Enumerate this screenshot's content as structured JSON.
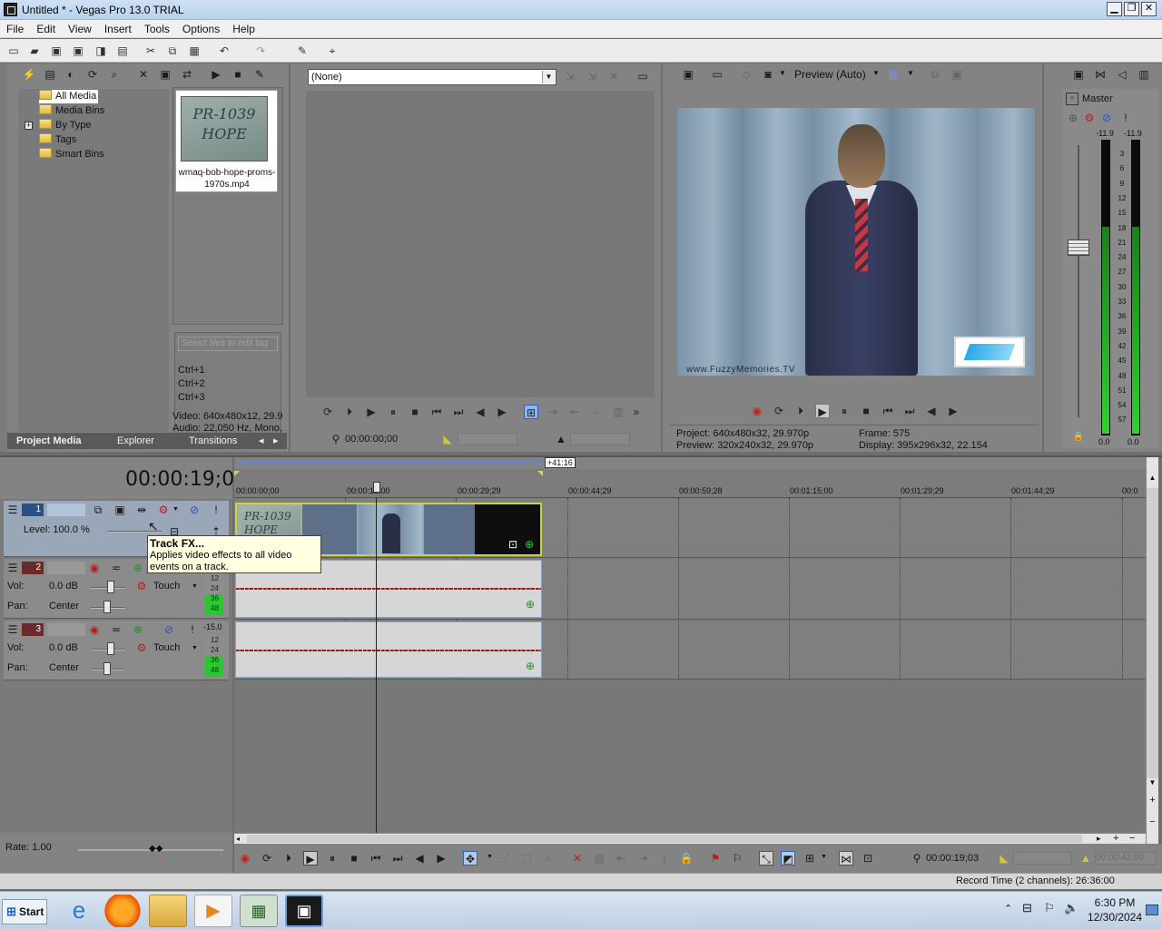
{
  "window": {
    "title": "Untitled * - Vegas Pro 13.0 TRIAL",
    "min": "▁",
    "restore": "❐",
    "close": "✕"
  },
  "menu": [
    "File",
    "Edit",
    "View",
    "Insert",
    "Tools",
    "Options",
    "Help"
  ],
  "project_media": {
    "tree": [
      "All Media",
      "Media Bins",
      "By Type",
      "Tags",
      "Smart Bins"
    ],
    "thumb_text": "PR-1039 HOPE",
    "file_name": "wmaq-bob-hope-proms-1970s.mp4",
    "tag_placeholder": "Select files to edit tag",
    "shortcuts": [
      "Ctrl+1",
      "Ctrl+2",
      "Ctrl+3"
    ],
    "video_info": "Video: 640x480x12, 29.9",
    "audio_info": "Audio: 22,050 Hz, Mono,",
    "tabs": [
      "Project Media",
      "Explorer",
      "Transitions"
    ]
  },
  "trimmer": {
    "combo": "(None)",
    "timecode": "00:00:00;00"
  },
  "preview": {
    "mode": "Preview (Auto)",
    "watermark": "www.FuzzyMemories.TV",
    "project": "Project:  640x480x32, 29.970p",
    "preview_res": "Preview:  320x240x32, 29.970p",
    "frame": "Frame:     575",
    "display": "Display:   395x296x32, 22.154"
  },
  "master": {
    "label": "Master",
    "peak_l": "-11.9",
    "peak_r": "-11.9",
    "scale": [
      "3",
      "6",
      "9",
      "12",
      "15",
      "18",
      "21",
      "24",
      "27",
      "30",
      "33",
      "36",
      "39",
      "42",
      "45",
      "48",
      "51",
      "54",
      "57"
    ],
    "bottom_l": "0.0",
    "bottom_r": "0.0"
  },
  "timeline": {
    "cursor_time": "00:00:19;03",
    "loop_label": "+41:16",
    "ruler": [
      "00:00:00;00",
      "00:00:15;00",
      "00:00:29;29",
      "00:00:44;29",
      "00:00:59;28",
      "00:01:15;00",
      "00:01:29;29",
      "00:01:44;29",
      "00:0"
    ],
    "tracks": [
      {
        "num": "1",
        "level": "Level: 100.0 %"
      },
      {
        "num": "2",
        "vol_label": "Vol:",
        "vol": "0.0 dB",
        "pan_label": "Pan:",
        "pan": "Center",
        "mode": "Touch",
        "meter": [
          "12",
          "24",
          "36",
          "48"
        ]
      },
      {
        "num": "3",
        "vol_label": "Vol:",
        "vol": "0.0 dB",
        "pan_label": "Pan:",
        "pan": "Center",
        "mode": "Touch",
        "peak": "-15.0",
        "meter": [
          "12",
          "24",
          "36",
          "48"
        ]
      }
    ],
    "tooltip_title": "Track FX...",
    "tooltip_body": "Applies video effects to all video events on a track.",
    "rate": "Rate: 1.00",
    "bottom_time": "00:00:19;03",
    "bottom_time2": "00:00:42;00",
    "record_time": "Record Time (2 channels): 26:36:00"
  },
  "taskbar": {
    "start": "Start",
    "time": "6:30 PM",
    "date": "12/30/2024"
  }
}
